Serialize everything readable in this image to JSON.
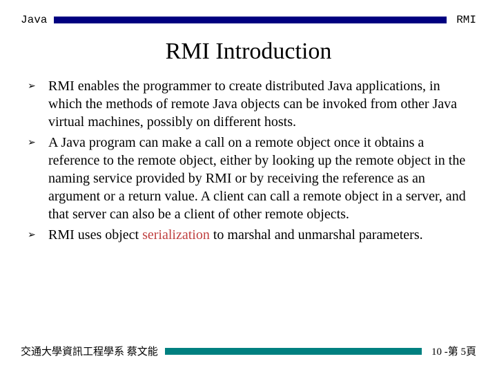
{
  "header": {
    "left": "Java",
    "right": "RMI"
  },
  "title": "RMI Introduction",
  "bullets": [
    {
      "text": "RMI enables the programmer to create distributed Java applications, in which the methods of remote Java objects can be invoked from other Java virtual machines, possibly on different hosts."
    },
    {
      "text": "A Java program can make a call on a remote object once it obtains a reference to the remote object, either by looking up the remote object in the naming service provided by RMI or by receiving the reference as an argument or a return value. A client can call a remote object in a server, and that server can also be a client of other remote objects."
    },
    {
      "pre": "RMI uses object ",
      "highlight": "serialization",
      "post": " to marshal and unmarshal parameters."
    }
  ],
  "footer": {
    "left": "交通大學資訊工程學系 蔡文能",
    "right": "10 -第 5頁"
  }
}
